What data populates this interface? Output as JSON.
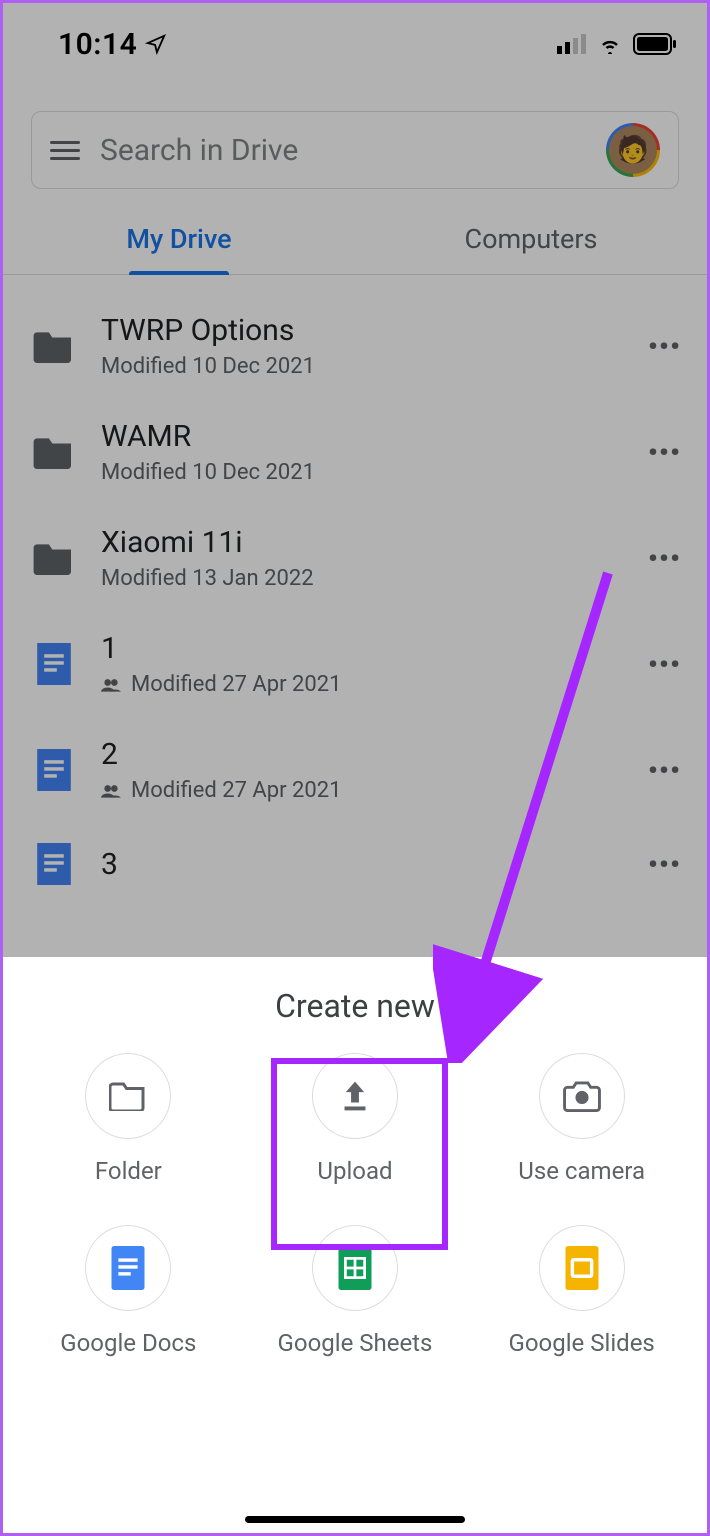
{
  "status": {
    "time": "10:14"
  },
  "search": {
    "placeholder": "Search in Drive"
  },
  "tabs": {
    "active": "My Drive",
    "other": "Computers"
  },
  "files": [
    {
      "name": "TWRP Options",
      "sub": "Modified 10 Dec 2021",
      "type": "folder",
      "shared": false
    },
    {
      "name": "WAMR",
      "sub": "Modified 10 Dec 2021",
      "type": "folder",
      "shared": false
    },
    {
      "name": "Xiaomi 11i",
      "sub": "Modified 13 Jan 2022",
      "type": "folder",
      "shared": false
    },
    {
      "name": "1",
      "sub": "Modified 27 Apr 2021",
      "type": "doc",
      "shared": true
    },
    {
      "name": "2",
      "sub": "Modified 27 Apr 2021",
      "type": "doc",
      "shared": true
    },
    {
      "name": "3",
      "sub": "",
      "type": "doc",
      "shared": false
    }
  ],
  "sheet": {
    "title": "Create new",
    "items": [
      {
        "label": "Folder",
        "icon": "folder-outline"
      },
      {
        "label": "Upload",
        "icon": "upload"
      },
      {
        "label": "Use camera",
        "icon": "camera"
      },
      {
        "label": "Google Docs",
        "icon": "gdocs"
      },
      {
        "label": "Google Sheets",
        "icon": "gsheets"
      },
      {
        "label": "Google Slides",
        "icon": "gslides"
      }
    ]
  },
  "annotation": {
    "highlight_target": "Upload"
  }
}
